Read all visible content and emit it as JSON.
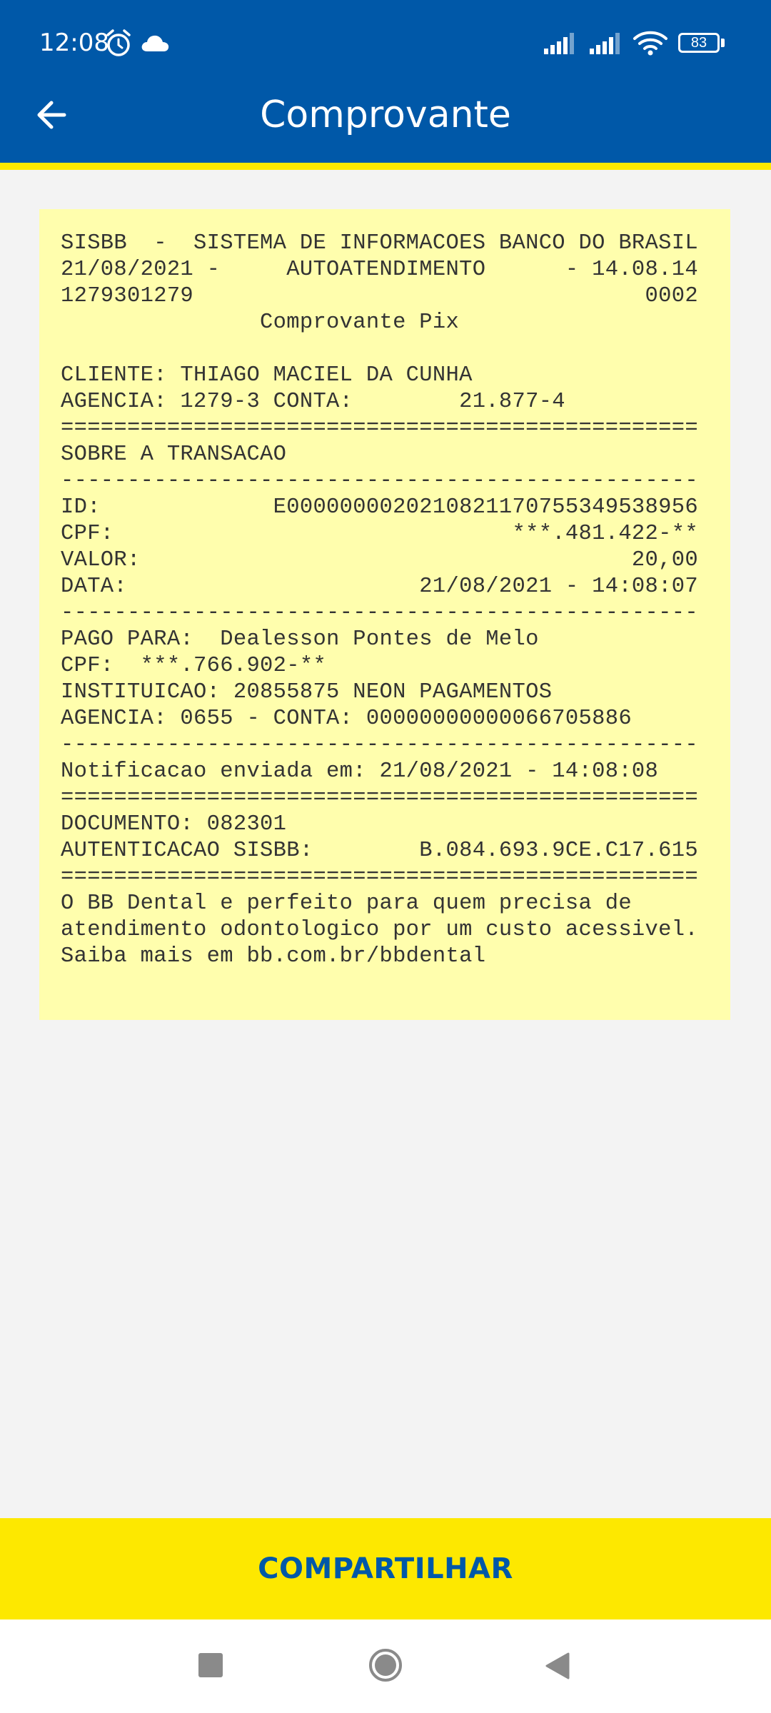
{
  "status_bar": {
    "time": "12:08",
    "icons": [
      "alarm-icon",
      "cloud-icon",
      "signal-icon",
      "signal-icon",
      "wifi-icon",
      "battery-icon"
    ],
    "battery_level": "83"
  },
  "header": {
    "title": "Comprovante",
    "back_icon": "arrow-left-icon"
  },
  "receipt": {
    "lines": [
      "SISBB  -  SISTEMA DE INFORMACOES BANCO DO BRASIL",
      "21/08/2021 -     AUTOATENDIMENTO      - 14.08.14",
      "1279301279                                  0002",
      "               Comprovante Pix",
      "",
      "CLIENTE: THIAGO MACIEL DA CUNHA",
      "AGENCIA: 1279-3 CONTA:        21.877-4",
      "================================================",
      "SOBRE A TRANSACAO",
      "------------------------------------------------",
      "ID:             E0000000020210821170755349538956",
      "CPF:                              ***.481.422-**",
      "VALOR:                                     20,00",
      "DATA:                      21/08/2021 - 14:08:07",
      "------------------------------------------------",
      "PAGO PARA:  Dealesson Pontes de Melo",
      "CPF:  ***.766.902-**",
      "INSTITUICAO: 20855875 NEON PAGAMENTOS",
      "AGENCIA: 0655 - CONTA: 00000000000066705886",
      "------------------------------------------------",
      "Notificacao enviada em: 21/08/2021 - 14:08:08",
      "================================================",
      "DOCUMENTO: 082301",
      "AUTENTICACAO SISBB:        B.084.693.9CE.C17.615",
      "================================================",
      "O BB Dental e perfeito para quem precisa de",
      "atendimento odontologico por um custo acessivel.",
      "Saiba mais em bb.com.br/bbdental"
    ]
  },
  "actions": {
    "share_label": "COMPARTILHAR"
  },
  "nav": {
    "icons": [
      "recent-apps-icon",
      "home-icon",
      "back-triangle-icon"
    ]
  },
  "colors": {
    "brand_blue": "#0058a8",
    "brand_yellow": "#fde800",
    "receipt_bg": "#fffead",
    "page_bg": "#f3f3f3"
  }
}
